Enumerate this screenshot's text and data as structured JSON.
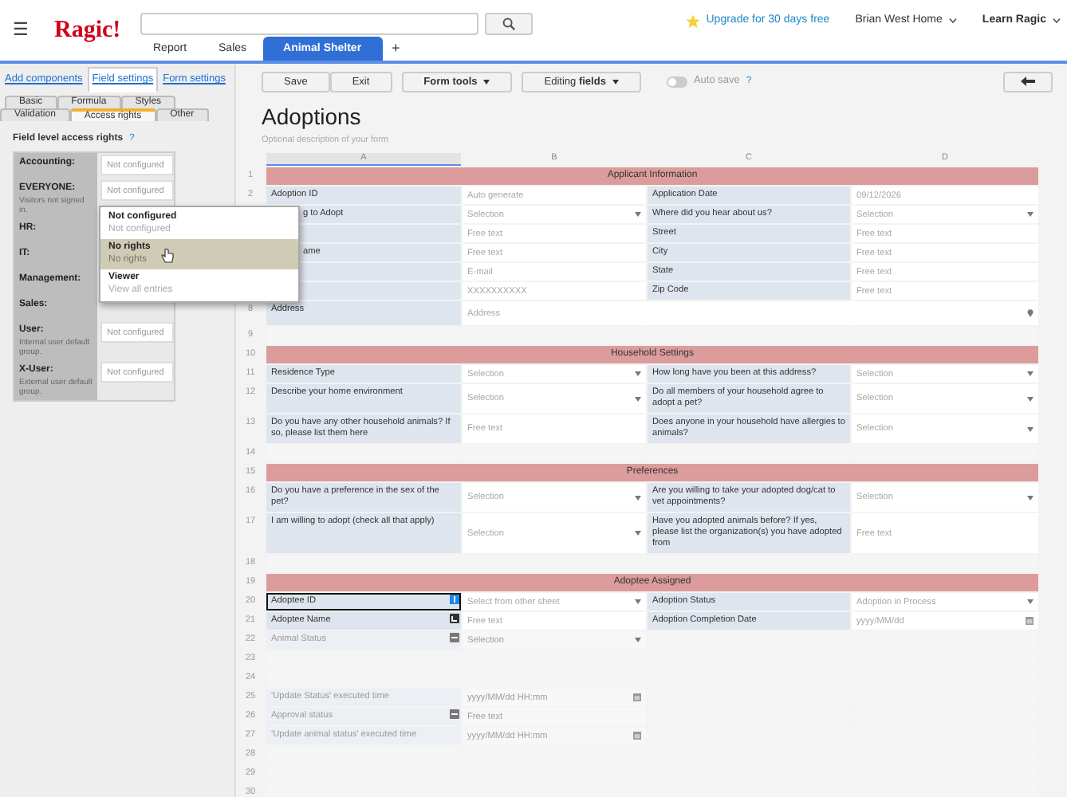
{
  "topbar": {
    "menu": "☰",
    "logo": "Ragic!",
    "upgrade": "Upgrade for 30 days free",
    "account": "Brian West Home",
    "help": "Learn Ragic"
  },
  "tabs": [
    {
      "label": "Report",
      "selected": false
    },
    {
      "label": "Sales",
      "selected": false
    },
    {
      "label": "Animal Shelter",
      "selected": true
    }
  ],
  "add_tab": "+",
  "left_panel": {
    "links": [
      {
        "label": "Add components",
        "selected": false
      },
      {
        "label": "Field settings",
        "selected": true
      },
      {
        "label": "Form settings",
        "selected": false
      }
    ],
    "subtabs": [
      [
        {
          "label": "Basic",
          "selected": false
        },
        {
          "label": "Formula",
          "selected": false
        },
        {
          "label": "Styles",
          "selected": false
        }
      ],
      [
        {
          "label": "Validation",
          "selected": false
        },
        {
          "label": "Access rights",
          "selected": true
        },
        {
          "label": "Other",
          "selected": false
        }
      ]
    ],
    "title": "Field level access rights",
    "help": "?",
    "groups": [
      {
        "name": "Accounting:",
        "value": "Not configured"
      },
      {
        "name": "EVERYONE:",
        "note": "Visitors not signed in.",
        "value": "Not configured"
      },
      {
        "name": "HR:"
      },
      {
        "name": "IT:"
      },
      {
        "name": "Management:"
      },
      {
        "name": "Sales:"
      },
      {
        "name": "User:",
        "note": "Internal user default group.",
        "value": "Not configured"
      },
      {
        "name": "X-User:",
        "note": "External user default group.",
        "value": "Not configured"
      }
    ],
    "menu": [
      {
        "title": "Not configured",
        "subtitle": "Not configured",
        "hovered": false
      },
      {
        "title": "No rights",
        "subtitle": "No rights",
        "hovered": true
      },
      {
        "title": "Viewer",
        "subtitle": "View all entries",
        "hovered": false
      }
    ]
  },
  "toolbar": {
    "buttons": [
      {
        "label": "Save",
        "kind": "plain"
      },
      {
        "label": "Exit",
        "kind": "plain"
      },
      {
        "label": "Form tools",
        "kind": "menu",
        "bold": true
      },
      {
        "label": "Editing **fields**",
        "kind": "menu"
      }
    ],
    "autosave": {
      "label": "Auto save",
      "on": false,
      "help": "?"
    }
  },
  "form": {
    "title": "Adoptions",
    "description": "Optional description of your form"
  },
  "columns": [
    {
      "label": "A",
      "selected": true
    },
    {
      "label": "B",
      "selected": false
    },
    {
      "label": "C",
      "selected": false
    },
    {
      "label": "D",
      "selected": false
    }
  ],
  "rows": [
    {
      "num": "1",
      "kind": "header",
      "title": "Applicant Information"
    },
    {
      "num": "2",
      "kind": "fields",
      "cells": [
        {
          "kind": "label",
          "text": "Adoption ID",
          "selected": false
        },
        {
          "kind": "input",
          "placeholder": "Auto generate"
        },
        {
          "kind": "label",
          "text": "Application Date",
          "selected": false
        },
        {
          "kind": "input",
          "placeholder": "09/12/2026"
        }
      ]
    },
    {
      "kind": "fields",
      "cells": [
        {
          "kind": "label",
          "text": "g to Adopt",
          "selected": false,
          "cut": true
        },
        {
          "kind": "input",
          "placeholder": "Selection",
          "dropdown": true
        },
        {
          "kind": "label",
          "text": "Where did you hear about us?",
          "selected": false
        },
        {
          "kind": "input",
          "placeholder": "Selection",
          "dropdown": true
        }
      ]
    },
    {
      "kind": "fields",
      "cells": [
        {
          "kind": "label",
          "selected": false
        },
        {
          "kind": "input",
          "placeholder": "Free text"
        },
        {
          "kind": "label",
          "text": "Street",
          "selected": false
        },
        {
          "kind": "input",
          "placeholder": "Free text"
        }
      ]
    },
    {
      "kind": "fields",
      "cells": [
        {
          "kind": "label",
          "text": "ame",
          "selected": false,
          "cut": true
        },
        {
          "kind": "input",
          "placeholder": "Free text"
        },
        {
          "kind": "label",
          "text": "City",
          "selected": false
        },
        {
          "kind": "input",
          "placeholder": "Free text"
        }
      ]
    },
    {
      "kind": "fields",
      "cells": [
        {
          "kind": "label",
          "selected": false
        },
        {
          "kind": "input",
          "placeholder": "E-mail"
        },
        {
          "kind": "label",
          "text": "State",
          "selected": false
        },
        {
          "kind": "input",
          "placeholder": "Free text"
        }
      ]
    },
    {
      "kind": "fields",
      "cells": [
        {
          "kind": "label",
          "selected": false
        },
        {
          "kind": "input",
          "placeholder": "XXXXXXXXXX"
        },
        {
          "kind": "label",
          "text": "Zip Code",
          "selected": false
        },
        {
          "kind": "input",
          "placeholder": "Free text"
        }
      ]
    },
    {
      "num": "8",
      "kind": "fields",
      "cells": [
        {
          "kind": "label",
          "text": "Address",
          "selected": false
        },
        {
          "kind": "input",
          "placeholder": "Address",
          "location": true,
          "wide": true
        }
      ]
    },
    {
      "num": "9",
      "kind": "empty"
    },
    {
      "num": "10",
      "kind": "header",
      "title": "Household Settings"
    },
    {
      "num": "11",
      "kind": "fields",
      "cells": [
        {
          "kind": "label",
          "text": "Residence Type",
          "selected": false
        },
        {
          "kind": "input",
          "placeholder": "Selection",
          "dropdown": true
        },
        {
          "kind": "label",
          "text": "How long have you been at this address?",
          "selected": false
        },
        {
          "kind": "input",
          "placeholder": "Selection",
          "dropdown": true
        }
      ]
    },
    {
      "num": "12",
      "kind": "fields",
      "cells": [
        {
          "kind": "label",
          "text": "Describe your home environment",
          "selected": false
        },
        {
          "kind": "input",
          "placeholder": "Selection",
          "dropdown": true
        },
        {
          "kind": "label",
          "text": "Do all members of your household agree to adopt a pet?",
          "selected": false
        },
        {
          "kind": "input",
          "placeholder": "Selection",
          "dropdown": true
        }
      ]
    },
    {
      "num": "13",
      "kind": "fields",
      "cells": [
        {
          "kind": "label",
          "text": "Do you have any other household animals? If so, please list them here",
          "selected": false
        },
        {
          "kind": "input",
          "placeholder": "Free text"
        },
        {
          "kind": "label",
          "text": "Does anyone in your household have allergies to animals?",
          "selected": false
        },
        {
          "kind": "input",
          "placeholder": "Selection",
          "dropdown": true
        }
      ]
    },
    {
      "num": "14",
      "kind": "empty"
    },
    {
      "num": "15",
      "kind": "header",
      "title": "Preferences"
    },
    {
      "num": "16",
      "kind": "fields",
      "cells": [
        {
          "kind": "label",
          "text": "Do you have a preference in the sex of the pet?",
          "selected": false
        },
        {
          "kind": "input",
          "placeholder": "Selection",
          "dropdown": true
        },
        {
          "kind": "label",
          "text": "Are you willing to take your adopted dog/cat to vet appointments?",
          "selected": false
        },
        {
          "kind": "input",
          "placeholder": "Selection",
          "dropdown": true
        }
      ]
    },
    {
      "num": "17",
      "kind": "fields",
      "cells": [
        {
          "kind": "label",
          "text": "I am willing to adopt (check all that apply)",
          "selected": false
        },
        {
          "kind": "input",
          "placeholder": "Selection",
          "dropdown": true
        },
        {
          "kind": "label",
          "text": "Have you adopted animals before? If yes, please list the organization(s) you have adopted from",
          "selected": false
        },
        {
          "kind": "input",
          "placeholder": "Free text"
        }
      ]
    },
    {
      "num": "18",
      "kind": "empty"
    },
    {
      "num": "19",
      "kind": "header",
      "title": "Adoptee Assigned"
    },
    {
      "num": "20",
      "kind": "fields",
      "cells": [
        {
          "kind": "label",
          "text": "Adoptee ID",
          "selected": true,
          "key_field": true
        },
        {
          "kind": "input",
          "placeholder": "Select from other sheet",
          "dropdown": true
        },
        {
          "kind": "label",
          "text": "Adoption Status",
          "selected": false
        },
        {
          "kind": "input",
          "placeholder": "Adoption in Process",
          "dropdown": true
        }
      ]
    },
    {
      "num": "21",
      "kind": "fields",
      "cells": [
        {
          "kind": "label",
          "text": "Adoptee Name",
          "selected": false,
          "linked": true
        },
        {
          "kind": "input",
          "placeholder": "Free text"
        },
        {
          "kind": "label",
          "text": "Adoption Completion Date",
          "selected": false
        },
        {
          "kind": "input",
          "placeholder": "yyyy/MM/dd",
          "date": true
        }
      ]
    },
    {
      "num": "22",
      "kind": "fields",
      "cells": [
        {
          "kind": "label",
          "text": "Animal Status",
          "selected": false,
          "disabled": true,
          "synced": true
        },
        {
          "kind": "input",
          "placeholder": "Selection",
          "dropdown": true,
          "disabled": true
        },
        {
          "kind": "blank"
        },
        {
          "kind": "blank"
        }
      ]
    },
    {
      "num": "23",
      "kind": "empty"
    },
    {
      "num": "24",
      "kind": "empty"
    },
    {
      "num": "25",
      "kind": "fields",
      "cells": [
        {
          "kind": "label",
          "text": "'Update Status' executed time",
          "selected": false,
          "disabled": true
        },
        {
          "kind": "input",
          "placeholder": "yyyy/MM/dd HH:mm",
          "date": true,
          "disabled": true
        },
        {
          "kind": "blank"
        },
        {
          "kind": "blank"
        }
      ]
    },
    {
      "num": "26",
      "kind": "fields",
      "cells": [
        {
          "kind": "label",
          "text": "Approval status",
          "selected": false,
          "disabled": true,
          "synced": true
        },
        {
          "kind": "input",
          "placeholder": "Free text",
          "disabled": true
        },
        {
          "kind": "blank"
        },
        {
          "kind": "blank"
        }
      ]
    },
    {
      "num": "27",
      "kind": "fields",
      "cells": [
        {
          "kind": "label",
          "text": "'Update animal status' executed time",
          "selected": false,
          "disabled": true
        },
        {
          "kind": "input",
          "placeholder": "yyyy/MM/dd HH:mm",
          "date": true,
          "disabled": true
        },
        {
          "kind": "blank"
        },
        {
          "kind": "blank"
        }
      ]
    },
    {
      "num": "28",
      "kind": "empty"
    },
    {
      "num": "29",
      "kind": "empty"
    },
    {
      "num": "30",
      "kind": "empty"
    }
  ]
}
